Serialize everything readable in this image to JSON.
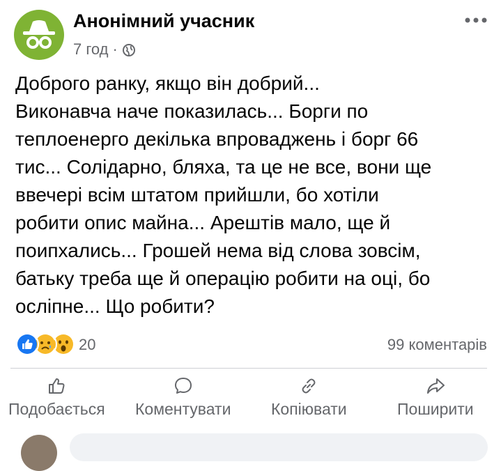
{
  "post": {
    "author": "Анонімний учасник",
    "time": "7 год",
    "separator": "·",
    "body_lines": [
      "Доброго ранку,  якщо він добрий...",
      "Виконавча наче показилась... Борги по",
      "теплоенерго декілька впроваджень і борг 66",
      "тис... Солідарно, бляха, та це не все, вони ще",
      "ввечері всім штатом прийшли,  бо хотіли",
      "робити опис майна... Арештів мало, ще й",
      "поипхались... Грошей нема від слова зовсім,",
      "батьку треба ще й операцію робити на оці, бо",
      "осліпне... Що робити?"
    ]
  },
  "stats": {
    "reaction_count": "20",
    "comment_count": "99 коментарів",
    "reactions": [
      "like-icon",
      "sad-icon",
      "wow-icon"
    ]
  },
  "actions": {
    "like": "Подобається",
    "comment": "Коментувати",
    "copy": "Копіювати",
    "share": "Поширити"
  },
  "colors": {
    "avatar_bg": "#7fb334",
    "meta_text": "#65676b",
    "like_blue": "#1877f2",
    "reaction_yellow": "#f7b928"
  }
}
